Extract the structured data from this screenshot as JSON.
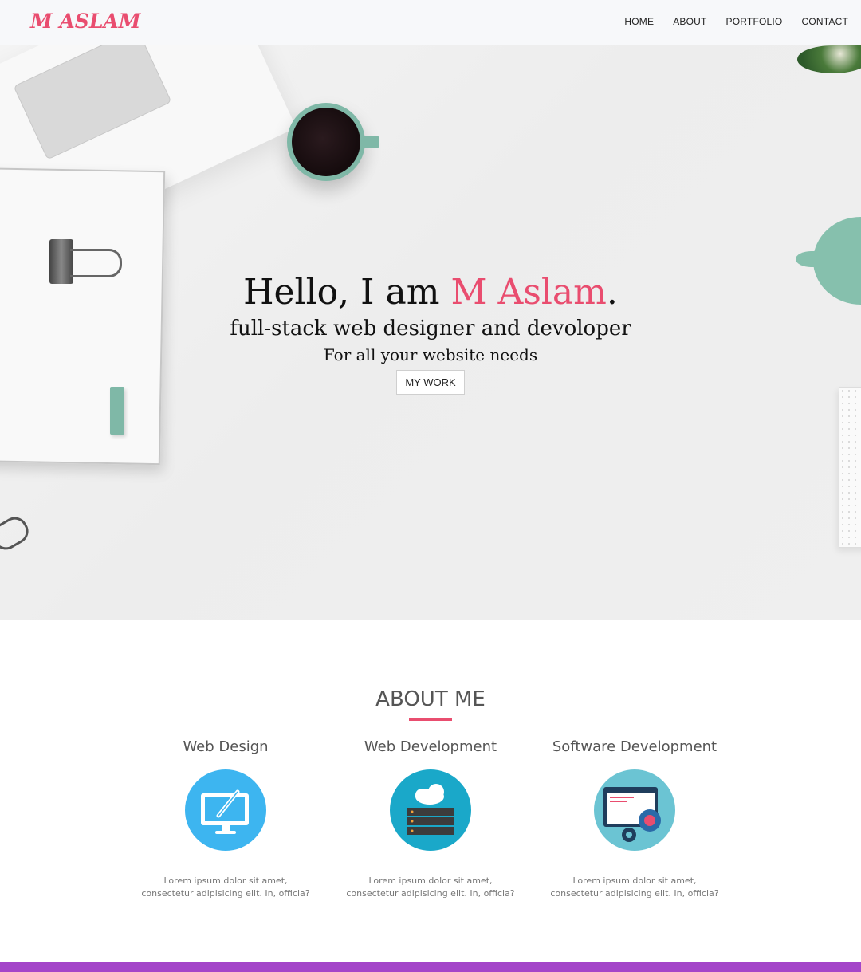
{
  "brand": "M ASLAM",
  "nav": {
    "home": "HOME",
    "about": "ABOUT",
    "portfolio": "PORTFOLIO",
    "contact": "CONTACT"
  },
  "hero": {
    "greeting": "Hello, I am",
    "name": "M Aslam",
    "period": ".",
    "subtitle": "full-stack web designer and devoloper",
    "tagline": "For all your website needs",
    "button": "MY WORK"
  },
  "about": {
    "title": "ABOUT ME",
    "items": [
      {
        "title": "Web Design",
        "icon": "monitor-pen-icon",
        "text": "Lorem ipsum dolor sit amet, consectetur adipisicing elit. In, officia?"
      },
      {
        "title": "Web Development",
        "icon": "cloud-server-icon",
        "text": "Lorem ipsum dolor sit amet, consectetur adipisicing elit. In, officia?"
      },
      {
        "title": "Software Development",
        "icon": "browser-gears-icon",
        "text": "Lorem ipsum dolor sit amet, consectetur adipisicing elit. In, officia?"
      }
    ]
  },
  "colors": {
    "accent": "#e94d6f",
    "footer": "#a445c9",
    "icon1": "#3db5f0",
    "icon2": "#1aa8c9",
    "icon3": "#6bc4d3"
  }
}
